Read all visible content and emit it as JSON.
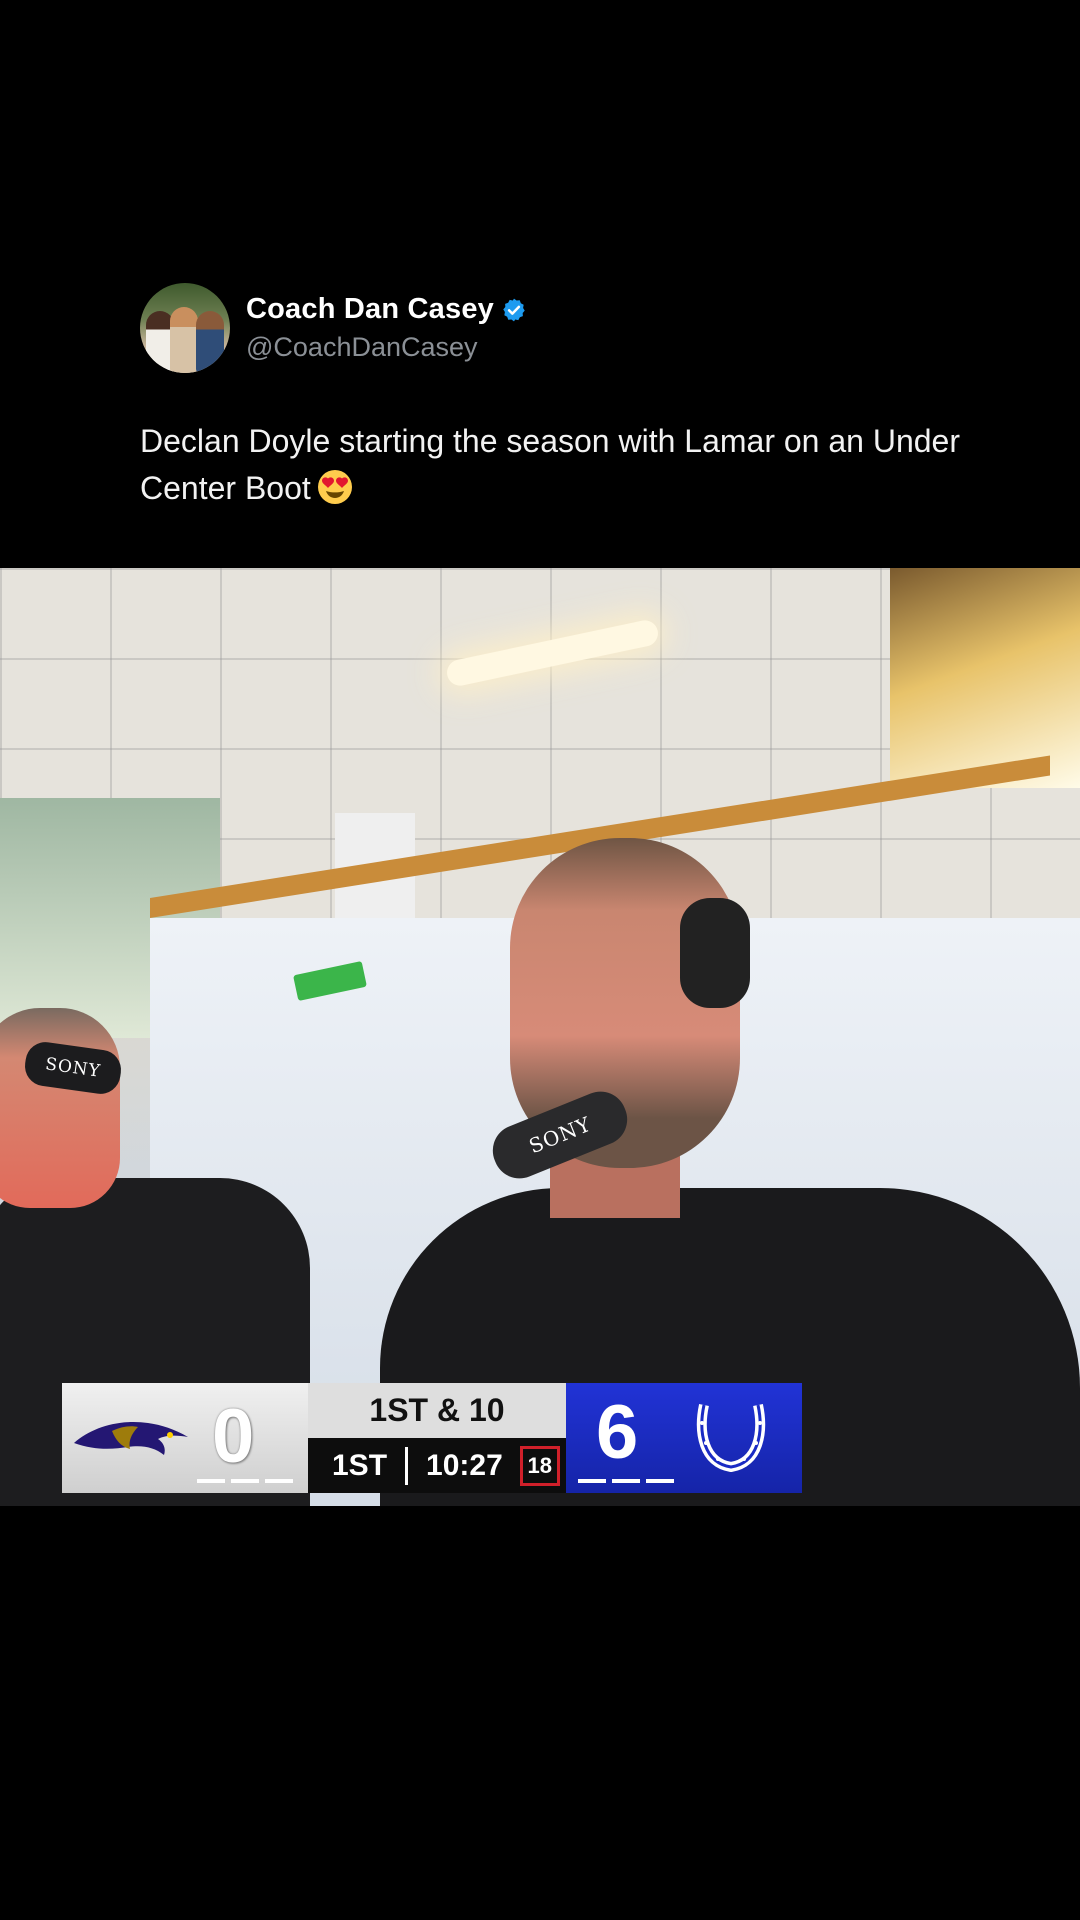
{
  "post": {
    "author": {
      "display_name": "Coach Dan Casey",
      "handle": "@CoachDanCasey",
      "verified_icon": "verified-badge-icon",
      "avatar": "avatar-photo"
    },
    "text": "Declan Doyle starting the season with Lamar on an Under Center Boot",
    "emoji_icon": "heart-eyes-emoji-icon"
  },
  "video": {
    "mic_brand": "SONY",
    "headset_brand": "SONY",
    "scoreboard": {
      "away_score": "0",
      "away_team_logo": "ravens-logo-icon",
      "down_distance": "1ST & 10",
      "quarter": "1ST",
      "game_clock": "10:27",
      "play_clock": "18",
      "home_score": "6",
      "home_team_logo": "colts-horseshoe-logo-icon"
    }
  },
  "colors": {
    "background": "#000000",
    "handle": "#8b9096",
    "verified": "#1d9bf0",
    "home_team": "#1a2bc4",
    "play_clock_border": "#d0202a"
  }
}
